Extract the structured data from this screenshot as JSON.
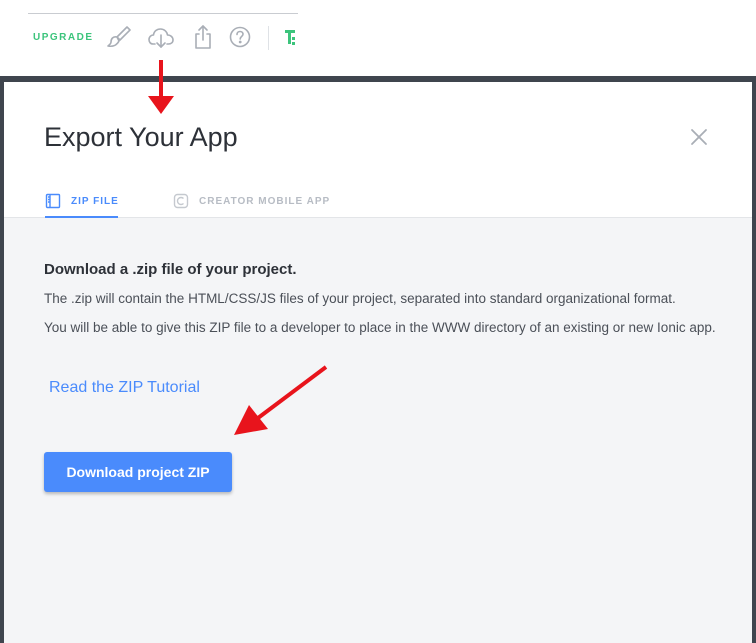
{
  "toolbar": {
    "upgrade_label": "UPGRADE",
    "icons": [
      "paintbrush-icon",
      "cloud-download-icon",
      "share-icon",
      "help-icon",
      "logo-icon"
    ]
  },
  "modal": {
    "title": "Export Your App",
    "tabs": [
      {
        "label": "ZIP FILE",
        "active": true
      },
      {
        "label": "CREATOR MOBILE APP",
        "active": false
      }
    ],
    "heading": "Download a .zip file of your project.",
    "paragraph1": "The .zip will contain the HTML/CSS/JS files of your project, separated into standard organizational format.",
    "paragraph2": "You will be able to give this ZIP file to a developer to place in the WWW directory of an existing or new Ionic app.",
    "tutorial_link": "Read the ZIP Tutorial",
    "download_button": "Download project ZIP"
  },
  "colors": {
    "accent": "#4a8bfc",
    "upgrade_green": "#3cc47c",
    "annotation_red": "#e8141c",
    "overlay": "#3f454e"
  }
}
